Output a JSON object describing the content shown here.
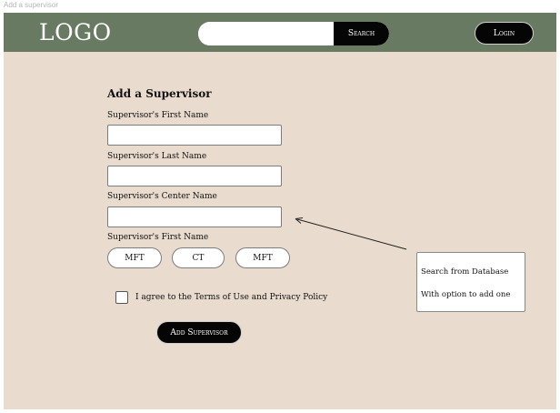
{
  "window": {
    "title": "Add a supervisor"
  },
  "header": {
    "logo": "LOGO",
    "search": {
      "placeholder": "",
      "button_label": "Search"
    },
    "login_label": "Login"
  },
  "form": {
    "title": "Add a Supervisor",
    "fields": [
      {
        "label": "Supervisor's First Name",
        "value": ""
      },
      {
        "label": "Supervisor's Last Name",
        "value": ""
      },
      {
        "label": "Supervisor's Center Name",
        "value": ""
      }
    ],
    "type_label": "Supervisor's First Name",
    "type_options": [
      "MFT",
      "CT",
      "MFT"
    ],
    "terms_label": "I agree to the Terms of Use and Privacy Policy",
    "terms_checked": false,
    "submit_label": "Add Supervisor"
  },
  "annotation": {
    "line1": "Search from Database",
    "line2": "With option to add one"
  },
  "colors": {
    "header_bg": "#697a62",
    "canvas_bg": "#e9dbce",
    "button_bg": "#050505"
  }
}
